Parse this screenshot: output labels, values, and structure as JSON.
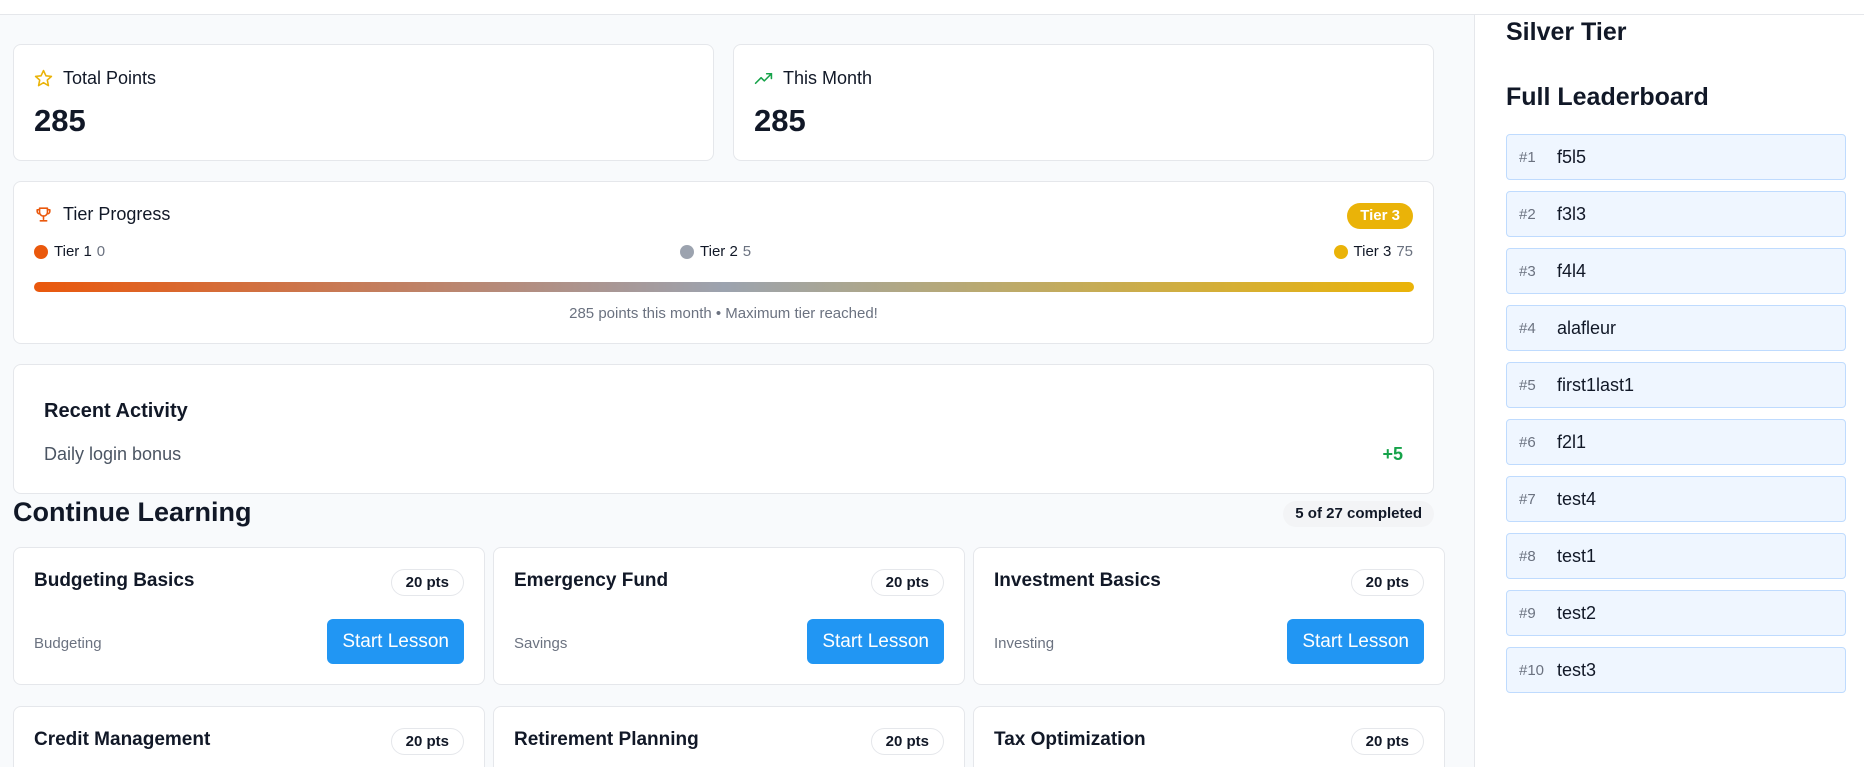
{
  "stats": {
    "total": {
      "label": "Total Points",
      "value": "285"
    },
    "month": {
      "label": "This Month",
      "value": "285"
    }
  },
  "tier_progress": {
    "title": "Tier Progress",
    "badge": "Tier 3",
    "tiers": [
      {
        "name": "Tier 1",
        "points": "0",
        "color": "#ea580c"
      },
      {
        "name": "Tier 2",
        "points": "5",
        "color": "#9ca3af"
      },
      {
        "name": "Tier 3",
        "points": "75",
        "color": "#eab308"
      }
    ],
    "progress_fraction": 1.0,
    "caption": "285 points this month • Maximum tier reached!"
  },
  "activity": {
    "title": "Recent Activity",
    "items": [
      {
        "description": "Daily login bonus",
        "points": "+5"
      }
    ]
  },
  "learning": {
    "title": "Continue Learning",
    "progress": "5 of 27 completed",
    "lessons": [
      {
        "title": "Budgeting Basics",
        "points": "20 pts",
        "category": "Budgeting",
        "button": "Start Lesson"
      },
      {
        "title": "Emergency Fund",
        "points": "20 pts",
        "category": "Savings",
        "button": "Start Lesson"
      },
      {
        "title": "Investment Basics",
        "points": "20 pts",
        "category": "Investing",
        "button": "Start Lesson"
      },
      {
        "title": "Credit Management",
        "points": "20 pts"
      },
      {
        "title": "Retirement Planning",
        "points": "20 pts"
      },
      {
        "title": "Tax Optimization",
        "points": "20 pts"
      }
    ]
  },
  "sidebar": {
    "tier_name": "Silver Tier",
    "leaderboard_title": "Full Leaderboard",
    "entries": [
      {
        "rank": "#1",
        "name": "f5l5"
      },
      {
        "rank": "#2",
        "name": "f3l3"
      },
      {
        "rank": "#3",
        "name": "f4l4"
      },
      {
        "rank": "#4",
        "name": "alafleur"
      },
      {
        "rank": "#5",
        "name": "first1last1"
      },
      {
        "rank": "#6",
        "name": "f2l1"
      },
      {
        "rank": "#7",
        "name": "test4"
      },
      {
        "rank": "#8",
        "name": "test1"
      },
      {
        "rank": "#9",
        "name": "test2"
      },
      {
        "rank": "#10",
        "name": "test3"
      }
    ]
  },
  "colors": {
    "accent_button": "#2196f3",
    "tier_badge": "#eab308",
    "positive_points": "#16a34a"
  },
  "icons": {
    "total_points": "star-icon",
    "this_month": "trending-up-icon",
    "tier_progress": "trophy-icon"
  }
}
